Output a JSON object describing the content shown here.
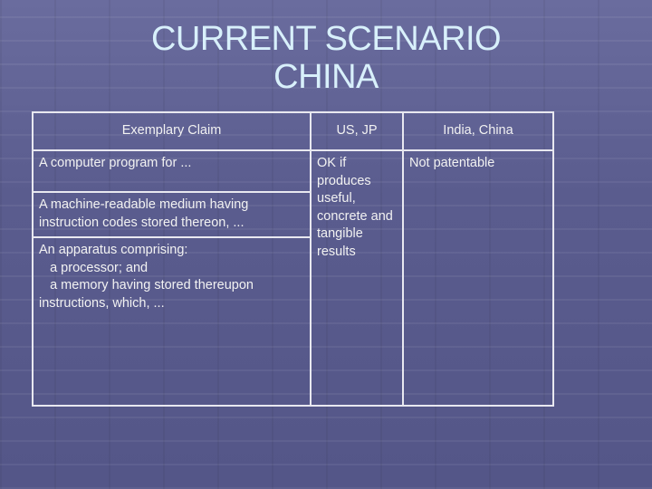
{
  "slide": {
    "title_line1": "CURRENT SCENARIO",
    "title_line2": "CHINA"
  },
  "table": {
    "headers": [
      "Exemplary Claim",
      "US, JP",
      "India, China"
    ],
    "claims": [
      "A computer program  for ...",
      "A machine-readable medium having instruction codes stored thereon, ...",
      "An apparatus comprising:\n   a processor; and\n   a memory having stored thereupon instructions, which, ..."
    ],
    "us_jp": "OK if produces useful, concrete and tangible results",
    "india_china": "Not patentable"
  }
}
